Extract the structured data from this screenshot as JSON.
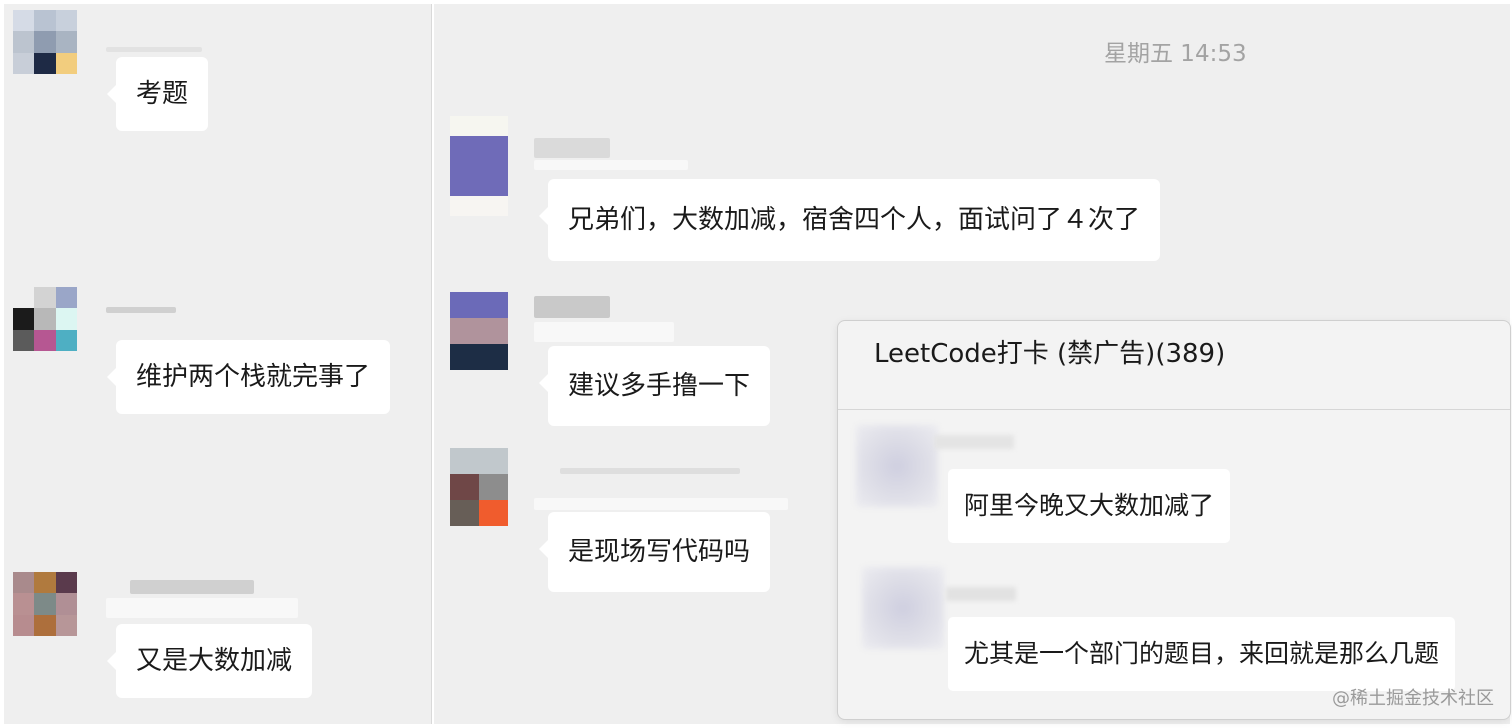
{
  "left_chat": {
    "messages": [
      {
        "text": "考题"
      },
      {
        "text": "维护两个栈就完事了"
      },
      {
        "text": "又是大数加减"
      }
    ]
  },
  "main_chat": {
    "timestamp": "星期五 14:53",
    "messages": [
      {
        "text": "兄弟们，大数加减，宿舍四个人，面试问了４次了"
      },
      {
        "text": "建议多手撸一下"
      },
      {
        "text": "是现场写代码吗"
      }
    ]
  },
  "group_popup": {
    "title": "LeetCode打卡 (禁广告)(389)",
    "messages": [
      {
        "text": "阿里今晚又大数加减了"
      },
      {
        "text": "尤其是一个部门的题目，来回就是那么几题"
      }
    ]
  },
  "watermark": "@稀土掘金技术社区",
  "colors": {
    "panel_background": "#efefef",
    "bubble_background": "#ffffff",
    "timestamp_text": "#a3a3a3"
  }
}
